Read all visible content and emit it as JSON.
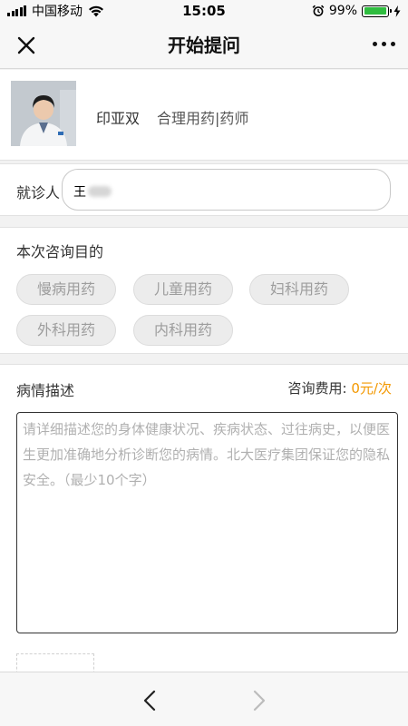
{
  "status_bar": {
    "carrier": "中国移动",
    "time": "15:05",
    "battery_percent": "99%",
    "battery_level": 0.99
  },
  "nav": {
    "title": "开始提问"
  },
  "doctor": {
    "name": "印亚双",
    "title": "合理用药|药师"
  },
  "patient": {
    "label": "就诊人",
    "value": "王"
  },
  "purpose": {
    "title": "本次咨询目的",
    "tags": [
      "慢病用药",
      "儿童用药",
      "妇科用药",
      "外科用药",
      "内科用药"
    ]
  },
  "description": {
    "title": "病情描述",
    "fee_label": "咨询费用:",
    "fee_value": "0元/次",
    "placeholder": "请详细描述您的身体健康状况、疾病状态、过往病史，以便医生更加准确地分析诊断您的病情。北大医疗集团保证您的隐私安全。（最少10个字）"
  },
  "colors": {
    "accent_fee": "#f39800",
    "battery_green": "#2fbd3f"
  }
}
